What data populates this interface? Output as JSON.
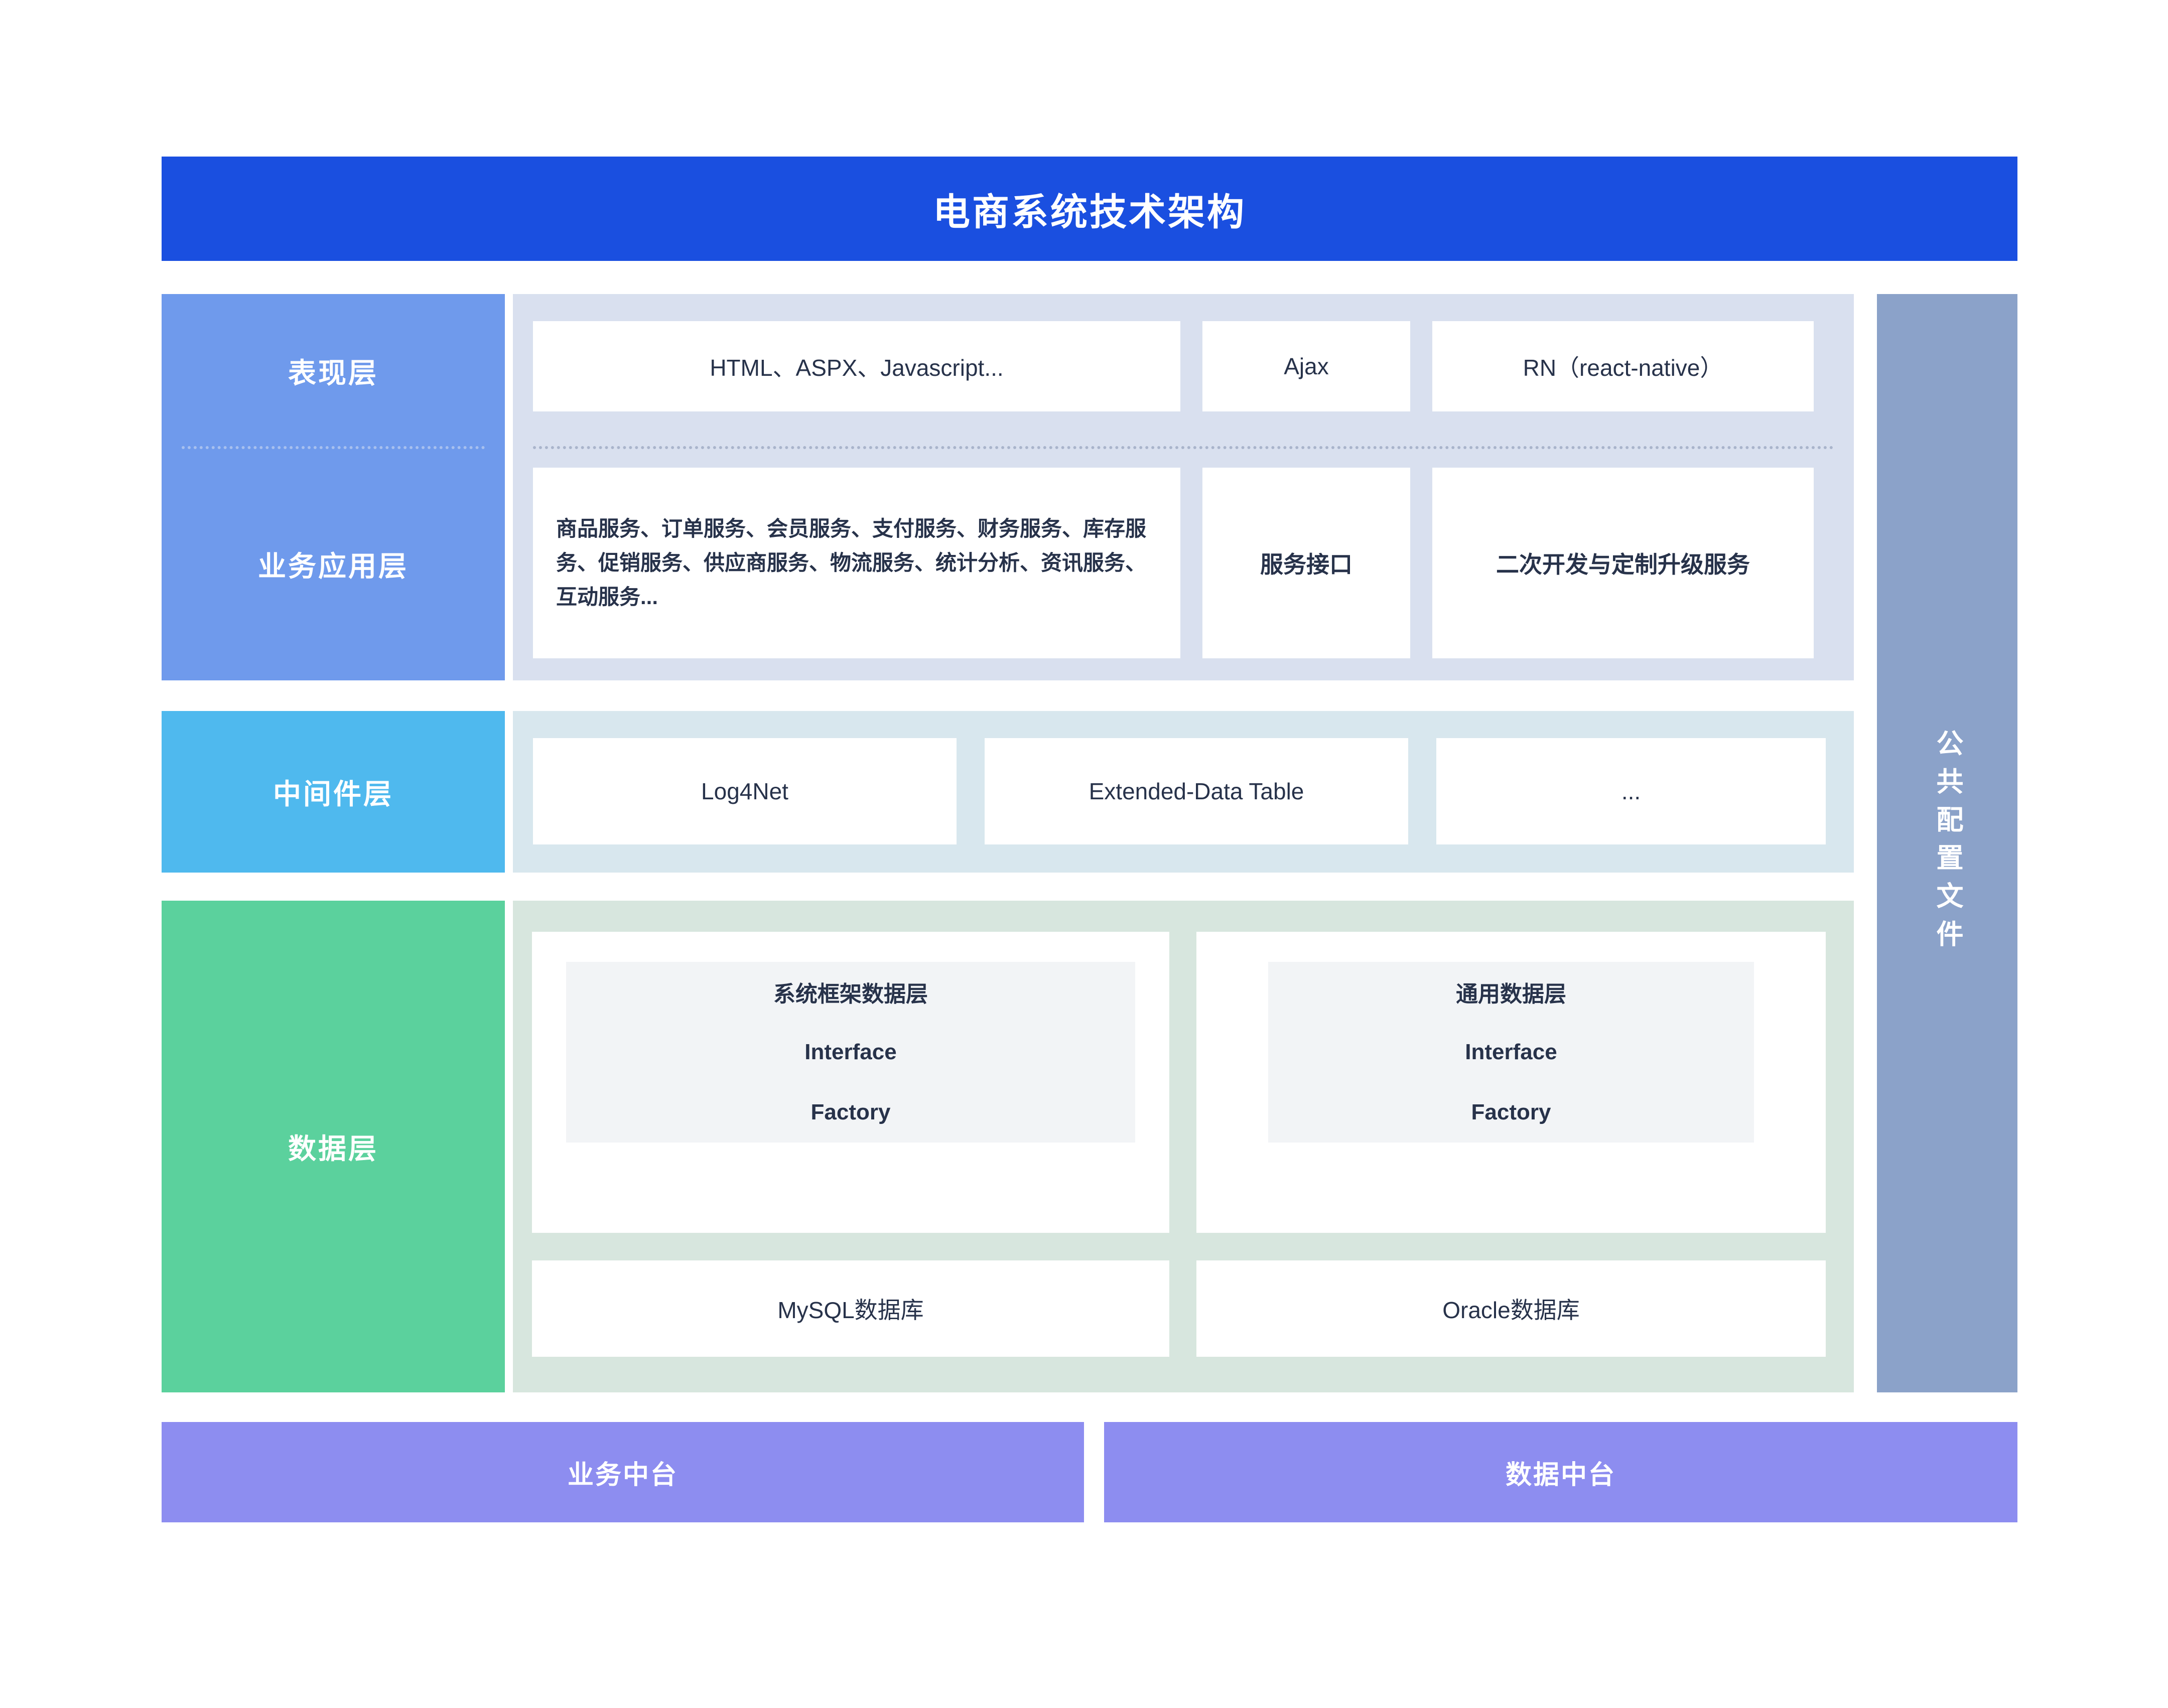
{
  "title": "电商系统技术架构",
  "colors": {
    "title_bar": "#1a4fe0",
    "presentation_layer": "#6f9aec",
    "business_layer": "#6f9aec",
    "middleware_layer": "#4fb9ee",
    "data_layer": "#5bd19d",
    "app_panel": "#d9e0ef",
    "middleware_panel": "#d8e7ee",
    "data_panel": "#d7e6de",
    "config_bar": "#8ba2c9",
    "platform_bar": "#8d8df0",
    "card": "#ffffff",
    "subcard": "#f2f4f6",
    "text_dark": "#27324a"
  },
  "layers": {
    "presentation": {
      "label": "表现层",
      "cards": [
        {
          "text": "HTML、ASPX、Javascript..."
        },
        {
          "text": "Ajax"
        },
        {
          "text": "RN（react-native）"
        }
      ]
    },
    "business": {
      "label": "业务应用层",
      "cards": [
        {
          "text": "商品服务、订单服务、会员服务、支付服务、财务服务、库存服务、促销服务、供应商服务、物流服务、统计分析、资讯服务、互动服务..."
        },
        {
          "text": "服务接口"
        },
        {
          "text": "二次开发与定制升级服务"
        }
      ]
    },
    "middleware": {
      "label": "中间件层",
      "cards": [
        {
          "text": "Log4Net"
        },
        {
          "text": "Extended-Data Table"
        },
        {
          "text": "..."
        }
      ]
    },
    "data": {
      "label": "数据层",
      "groups": [
        {
          "title": "系统框架数据层",
          "items": [
            "Interface",
            "Factory"
          ],
          "database": "MySQL数据库"
        },
        {
          "title": "通用数据层",
          "items": [
            "Interface",
            "Factory"
          ],
          "database": "Oracle数据库"
        }
      ]
    }
  },
  "config_bar": {
    "label": "公共配置文件"
  },
  "platforms": [
    {
      "label": "业务中台"
    },
    {
      "label": "数据中台"
    }
  ]
}
